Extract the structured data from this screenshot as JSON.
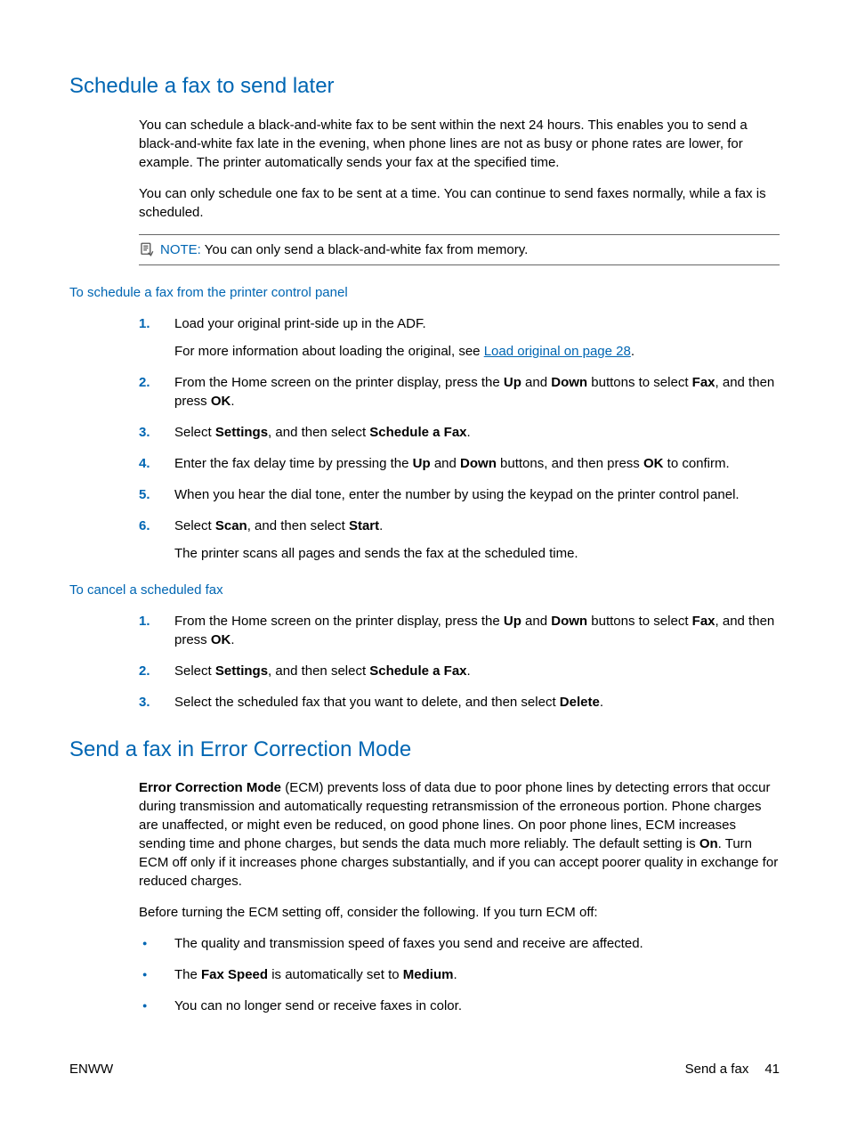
{
  "h2_schedule": "Schedule a fax to send later",
  "schedule_p1": "You can schedule a black-and-white fax to be sent within the next 24 hours. This enables you to send a black-and-white fax late in the evening, when phone lines are not as busy or phone rates are lower, for example. The printer automatically sends your fax at the specified time.",
  "schedule_p2": "You can only schedule one fax to be sent at a time. You can continue to send faxes normally, while a fax is scheduled.",
  "note_label": "NOTE:",
  "note_text": "You can only send a black-and-white fax from memory.",
  "sub_schedule_from_panel": "To schedule a fax from the printer control panel",
  "step1_text": "Load your original print-side up in the ADF.",
  "step1_more_prefix": "For more information about loading the original, see ",
  "step1_link": "Load original on page 28",
  "step1_more_suffix": ".",
  "step2_pre": "From the Home screen on the printer display, press the ",
  "up": "Up",
  "and": " and ",
  "down": "Down",
  "step2_mid": " buttons to select ",
  "fax": "Fax",
  "step2_tail": ", and then press ",
  "ok": "OK",
  "period": ".",
  "step3_pre": "Select ",
  "settings": "Settings",
  "step3_mid": ", and then select ",
  "schedule_a_fax": "Schedule a Fax",
  "step4_pre": "Enter the fax delay time by pressing the ",
  "step4_mid": " buttons, and then press ",
  "step4_tail": " to confirm.",
  "step5": "When you hear the dial tone, enter the number by using the keypad on the printer control panel.",
  "step6_pre": "Select ",
  "scan": "Scan",
  "step6_mid": ", and then select ",
  "start": "Start",
  "step6_p2": "The printer scans all pages and sends the fax at the scheduled time.",
  "sub_cancel": "To cancel a scheduled fax",
  "cancel3_pre": "Select the scheduled fax that you want to delete, and then select ",
  "delete": "Delete",
  "h2_ecm": "Send a fax in Error Correction Mode",
  "ecm_bold": "Error Correction Mode",
  "ecm_p1_mid": " (ECM) prevents loss of data due to poor phone lines by detecting errors that occur during transmission and automatically requesting retransmission of the erroneous portion. Phone charges are unaffected, or might even be reduced, on good phone lines. On poor phone lines, ECM increases sending time and phone charges, but sends the data much more reliably. The default setting is ",
  "on": "On",
  "ecm_p1_tail": ". Turn ECM off only if it increases phone charges substantially, and if you can accept poorer quality in exchange for reduced charges.",
  "ecm_p2": "Before turning the ECM setting off, consider the following. If you turn ECM off:",
  "bullet1": "The quality and transmission speed of faxes you send and receive are affected.",
  "bullet2_pre": "The ",
  "fax_speed": "Fax Speed",
  "bullet2_mid": " is automatically set to ",
  "medium": "Medium",
  "bullet3": "You can no longer send or receive faxes in color.",
  "footer_left": "ENWW",
  "footer_section": "Send a fax",
  "footer_page": "41"
}
